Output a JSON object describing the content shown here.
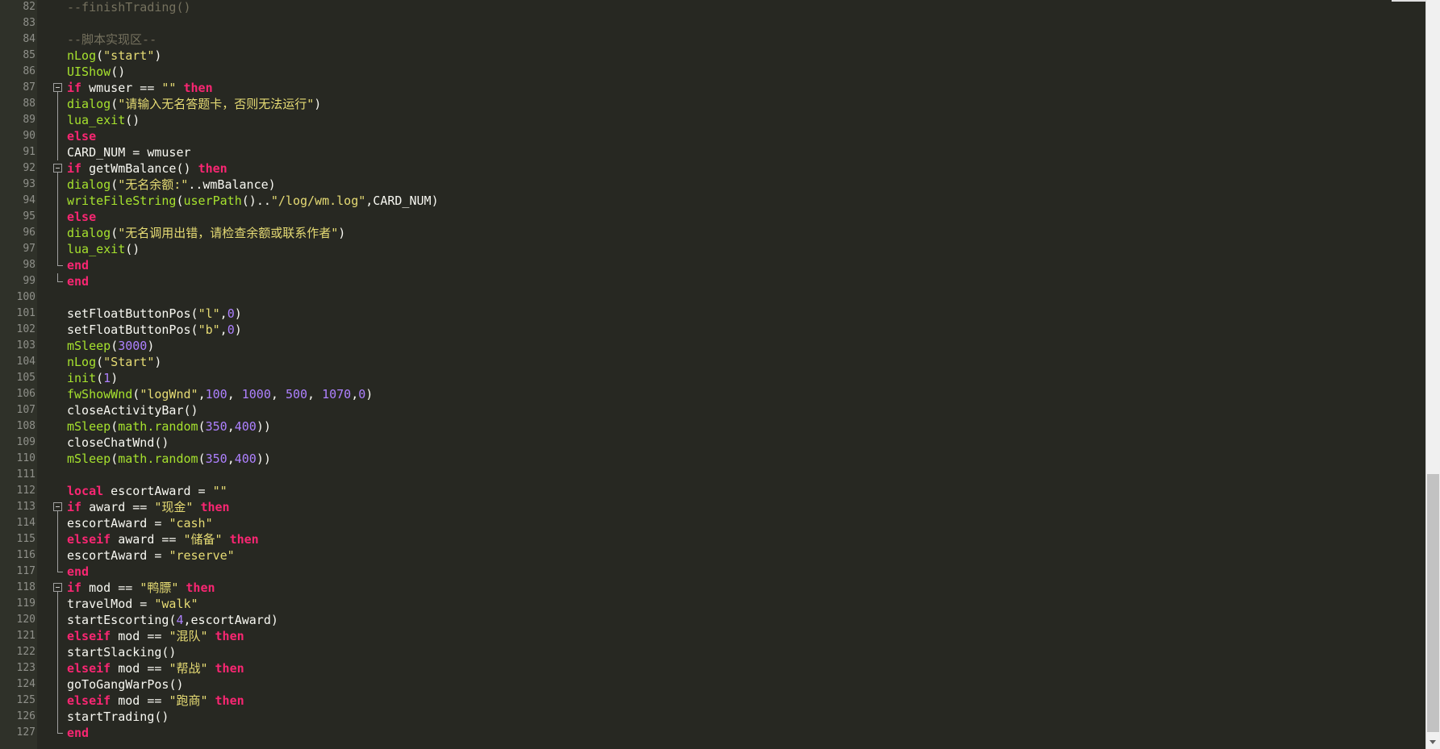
{
  "editor": {
    "lines": [
      {
        "n": "82",
        "tokens": [
          [
            "cm",
            "--finishTrading()"
          ]
        ]
      },
      {
        "n": "83",
        "tokens": []
      },
      {
        "n": "84",
        "tokens": [
          [
            "cm",
            "--脚本实现区--"
          ]
        ]
      },
      {
        "n": "85",
        "tokens": [
          [
            "fn",
            "nLog"
          ],
          [
            "punc",
            "("
          ],
          [
            "str",
            "\"start\""
          ],
          [
            "punc",
            ")"
          ]
        ]
      },
      {
        "n": "86",
        "tokens": [
          [
            "fn",
            "UIShow"
          ],
          [
            "punc",
            "()"
          ]
        ]
      },
      {
        "n": "87",
        "fold": "start",
        "tokens": [
          [
            "kw",
            "if"
          ],
          [
            "plain",
            " wmuser == "
          ],
          [
            "str",
            "\"\""
          ],
          [
            "plain",
            " "
          ],
          [
            "kw",
            "then"
          ]
        ]
      },
      {
        "n": "88",
        "fold": "mid",
        "tokens": [
          [
            "fn",
            "dialog"
          ],
          [
            "punc",
            "("
          ],
          [
            "str",
            "\"请输入无名答题卡，否则无法运行\""
          ],
          [
            "punc",
            ")"
          ]
        ]
      },
      {
        "n": "89",
        "fold": "mid",
        "tokens": [
          [
            "fn",
            "lua_exit"
          ],
          [
            "punc",
            "()"
          ]
        ]
      },
      {
        "n": "90",
        "fold": "mid",
        "tokens": [
          [
            "kw",
            "else"
          ]
        ]
      },
      {
        "n": "91",
        "fold": "mid",
        "tokens": [
          [
            "plain",
            "CARD_NUM = wmuser"
          ]
        ]
      },
      {
        "n": "92",
        "fold": "start",
        "tokens": [
          [
            "kw",
            "if"
          ],
          [
            "plain",
            " getWmBalance"
          ],
          [
            "punc",
            "()"
          ],
          [
            "plain",
            " "
          ],
          [
            "kw",
            "then"
          ]
        ]
      },
      {
        "n": "93",
        "fold": "mid",
        "tokens": [
          [
            "fn",
            "dialog"
          ],
          [
            "punc",
            "("
          ],
          [
            "str",
            "\"无名余额:\""
          ],
          [
            "plain",
            "..wmBalance"
          ],
          [
            "punc",
            ")"
          ]
        ]
      },
      {
        "n": "94",
        "fold": "mid",
        "tokens": [
          [
            "fn",
            "writeFileString"
          ],
          [
            "punc",
            "("
          ],
          [
            "fn",
            "userPath"
          ],
          [
            "punc",
            "()"
          ],
          [
            "plain",
            ".."
          ],
          [
            "str",
            "\"/log/wm.log\""
          ],
          [
            "plain",
            ",CARD_NUM"
          ],
          [
            "punc",
            ")"
          ]
        ]
      },
      {
        "n": "95",
        "fold": "mid",
        "tokens": [
          [
            "kw",
            "else"
          ]
        ]
      },
      {
        "n": "96",
        "fold": "mid",
        "tokens": [
          [
            "fn",
            "dialog"
          ],
          [
            "punc",
            "("
          ],
          [
            "str",
            "\"无名调用出错，请检查余额或联系作者\""
          ],
          [
            "punc",
            ")"
          ]
        ]
      },
      {
        "n": "97",
        "fold": "mid",
        "tokens": [
          [
            "fn",
            "lua_exit"
          ],
          [
            "punc",
            "()"
          ]
        ]
      },
      {
        "n": "98",
        "fold": "end",
        "tokens": [
          [
            "kw",
            "end"
          ]
        ]
      },
      {
        "n": "99",
        "fold": "end",
        "tokens": [
          [
            "kw",
            "end"
          ]
        ]
      },
      {
        "n": "100",
        "tokens": []
      },
      {
        "n": "101",
        "tokens": [
          [
            "plain",
            "setFloatButtonPos"
          ],
          [
            "punc",
            "("
          ],
          [
            "str",
            "\"l\""
          ],
          [
            "plain",
            ","
          ],
          [
            "num",
            "0"
          ],
          [
            "punc",
            ")"
          ]
        ]
      },
      {
        "n": "102",
        "tokens": [
          [
            "plain",
            "setFloatButtonPos"
          ],
          [
            "punc",
            "("
          ],
          [
            "str",
            "\"b\""
          ],
          [
            "plain",
            ","
          ],
          [
            "num",
            "0"
          ],
          [
            "punc",
            ")"
          ]
        ]
      },
      {
        "n": "103",
        "tokens": [
          [
            "fn",
            "mSleep"
          ],
          [
            "punc",
            "("
          ],
          [
            "num",
            "3000"
          ],
          [
            "punc",
            ")"
          ]
        ]
      },
      {
        "n": "104",
        "tokens": [
          [
            "fn",
            "nLog"
          ],
          [
            "punc",
            "("
          ],
          [
            "str",
            "\"Start\""
          ],
          [
            "punc",
            ")"
          ]
        ]
      },
      {
        "n": "105",
        "tokens": [
          [
            "fn",
            "init"
          ],
          [
            "punc",
            "("
          ],
          [
            "num",
            "1"
          ],
          [
            "punc",
            ")"
          ]
        ]
      },
      {
        "n": "106",
        "tokens": [
          [
            "fn",
            "fwShowWnd"
          ],
          [
            "punc",
            "("
          ],
          [
            "str",
            "\"logWnd\""
          ],
          [
            "plain",
            ","
          ],
          [
            "num",
            "100"
          ],
          [
            "plain",
            ", "
          ],
          [
            "num",
            "1000"
          ],
          [
            "plain",
            ", "
          ],
          [
            "num",
            "500"
          ],
          [
            "plain",
            ", "
          ],
          [
            "num",
            "1070"
          ],
          [
            "plain",
            ","
          ],
          [
            "num",
            "0"
          ],
          [
            "punc",
            ")"
          ]
        ]
      },
      {
        "n": "107",
        "tokens": [
          [
            "plain",
            "closeActivityBar"
          ],
          [
            "punc",
            "()"
          ]
        ]
      },
      {
        "n": "108",
        "tokens": [
          [
            "fn",
            "mSleep"
          ],
          [
            "punc",
            "("
          ],
          [
            "fn",
            "math.random"
          ],
          [
            "punc",
            "("
          ],
          [
            "num",
            "350"
          ],
          [
            "plain",
            ","
          ],
          [
            "num",
            "400"
          ],
          [
            "punc",
            "))"
          ]
        ]
      },
      {
        "n": "109",
        "tokens": [
          [
            "plain",
            "closeChatWnd"
          ],
          [
            "punc",
            "()"
          ]
        ]
      },
      {
        "n": "110",
        "tokens": [
          [
            "fn",
            "mSleep"
          ],
          [
            "punc",
            "("
          ],
          [
            "fn",
            "math.random"
          ],
          [
            "punc",
            "("
          ],
          [
            "num",
            "350"
          ],
          [
            "plain",
            ","
          ],
          [
            "num",
            "400"
          ],
          [
            "punc",
            "))"
          ]
        ]
      },
      {
        "n": "111",
        "tokens": []
      },
      {
        "n": "112",
        "tokens": [
          [
            "kw",
            "local"
          ],
          [
            "plain",
            " escortAward = "
          ],
          [
            "str",
            "\"\""
          ]
        ]
      },
      {
        "n": "113",
        "fold": "start",
        "tokens": [
          [
            "kw",
            "if"
          ],
          [
            "plain",
            " award == "
          ],
          [
            "str",
            "\"现金\""
          ],
          [
            "plain",
            " "
          ],
          [
            "kw",
            "then"
          ]
        ]
      },
      {
        "n": "114",
        "fold": "mid",
        "tokens": [
          [
            "plain",
            "escortAward = "
          ],
          [
            "str",
            "\"cash\""
          ]
        ]
      },
      {
        "n": "115",
        "fold": "mid",
        "tokens": [
          [
            "kw",
            "elseif"
          ],
          [
            "plain",
            " award == "
          ],
          [
            "str",
            "\"储备\""
          ],
          [
            "plain",
            " "
          ],
          [
            "kw",
            "then"
          ]
        ]
      },
      {
        "n": "116",
        "fold": "mid",
        "tokens": [
          [
            "plain",
            "escortAward = "
          ],
          [
            "str",
            "\"reserve\""
          ]
        ]
      },
      {
        "n": "117",
        "fold": "end",
        "tokens": [
          [
            "kw",
            "end"
          ]
        ]
      },
      {
        "n": "118",
        "fold": "start",
        "tokens": [
          [
            "kw",
            "if"
          ],
          [
            "plain",
            " mod == "
          ],
          [
            "str",
            "\"鸭膘\""
          ],
          [
            "plain",
            " "
          ],
          [
            "kw",
            "then"
          ]
        ]
      },
      {
        "n": "119",
        "fold": "mid",
        "tokens": [
          [
            "plain",
            "travelMod = "
          ],
          [
            "str",
            "\"walk\""
          ]
        ]
      },
      {
        "n": "120",
        "fold": "mid",
        "tokens": [
          [
            "plain",
            "startEscorting"
          ],
          [
            "punc",
            "("
          ],
          [
            "num",
            "4"
          ],
          [
            "plain",
            ",escortAward"
          ],
          [
            "punc",
            ")"
          ]
        ]
      },
      {
        "n": "121",
        "fold": "mid",
        "tokens": [
          [
            "kw",
            "elseif"
          ],
          [
            "plain",
            " mod == "
          ],
          [
            "str",
            "\"混队\""
          ],
          [
            "plain",
            " "
          ],
          [
            "kw",
            "then"
          ]
        ]
      },
      {
        "n": "122",
        "fold": "mid",
        "tokens": [
          [
            "plain",
            "startSlacking"
          ],
          [
            "punc",
            "()"
          ]
        ]
      },
      {
        "n": "123",
        "fold": "mid",
        "tokens": [
          [
            "kw",
            "elseif"
          ],
          [
            "plain",
            " mod == "
          ],
          [
            "str",
            "\"帮战\""
          ],
          [
            "plain",
            " "
          ],
          [
            "kw",
            "then"
          ]
        ]
      },
      {
        "n": "124",
        "fold": "mid",
        "tokens": [
          [
            "plain",
            "goToGangWarPos"
          ],
          [
            "punc",
            "()"
          ]
        ]
      },
      {
        "n": "125",
        "fold": "mid",
        "tokens": [
          [
            "kw",
            "elseif"
          ],
          [
            "plain",
            " mod == "
          ],
          [
            "str",
            "\"跑商\""
          ],
          [
            "plain",
            " "
          ],
          [
            "kw",
            "then"
          ]
        ]
      },
      {
        "n": "126",
        "fold": "mid",
        "tokens": [
          [
            "plain",
            "startTrading"
          ],
          [
            "punc",
            "()"
          ]
        ]
      },
      {
        "n": "127",
        "fold": "end",
        "tokens": [
          [
            "kw",
            "end"
          ]
        ]
      }
    ]
  },
  "colors": {
    "background": "#272822",
    "keyword": "#f92672",
    "function": "#a6e22e",
    "string": "#e6db74",
    "number": "#ae81ff",
    "comment": "#75715e",
    "text": "#f8f8f2",
    "line_number": "#8f908a"
  },
  "scrollbar": {
    "icons": [
      "chevron-down-icon"
    ],
    "position": 0.82
  }
}
